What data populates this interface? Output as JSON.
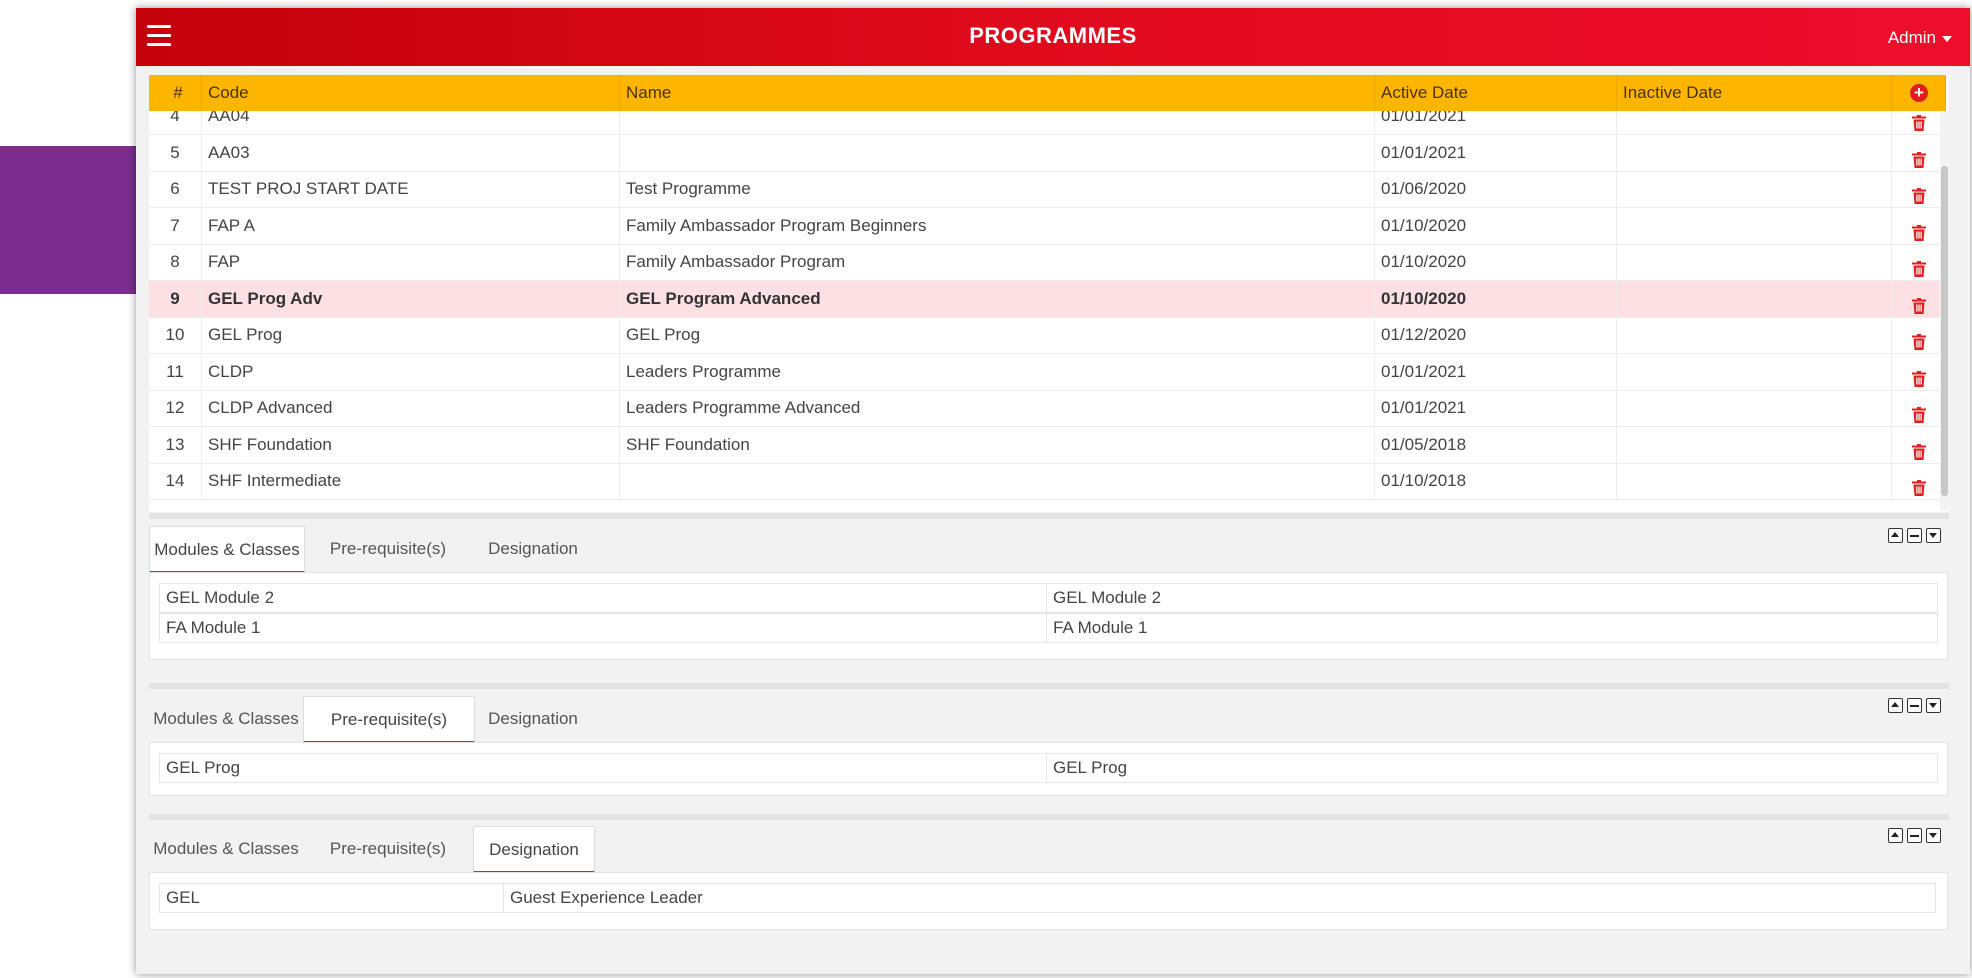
{
  "header": {
    "title": "PROGRAMMES",
    "user_menu": "Admin"
  },
  "grid": {
    "columns": [
      "#",
      "Code",
      "Name",
      "Active Date",
      "Inactive Date"
    ],
    "rows": [
      {
        "num": "4",
        "code": "AA04",
        "name": "",
        "active": "01/01/2021",
        "inactive": ""
      },
      {
        "num": "5",
        "code": "AA03",
        "name": "",
        "active": "01/01/2021",
        "inactive": ""
      },
      {
        "num": "6",
        "code": "TEST PROJ START DATE",
        "name": "Test Programme",
        "active": "01/06/2020",
        "inactive": ""
      },
      {
        "num": "7",
        "code": "FAP A",
        "name": "Family Ambassador Program Beginners",
        "active": "01/10/2020",
        "inactive": ""
      },
      {
        "num": "8",
        "code": "FAP",
        "name": "Family Ambassador Program",
        "active": "01/10/2020",
        "inactive": ""
      },
      {
        "num": "9",
        "code": "GEL Prog Adv",
        "name": "GEL Program Advanced",
        "active": "01/10/2020",
        "inactive": ""
      },
      {
        "num": "10",
        "code": "GEL Prog",
        "name": "GEL Prog",
        "active": "01/12/2020",
        "inactive": ""
      },
      {
        "num": "11",
        "code": "CLDP",
        "name": "Leaders Programme",
        "active": "01/01/2021",
        "inactive": ""
      },
      {
        "num": "12",
        "code": "CLDP Advanced",
        "name": "Leaders Programme Advanced",
        "active": "01/01/2021",
        "inactive": ""
      },
      {
        "num": "13",
        "code": "SHF Foundation",
        "name": "SHF Foundation",
        "active": "01/05/2018",
        "inactive": ""
      },
      {
        "num": "14",
        "code": "SHF Intermediate",
        "name": "",
        "active": "01/10/2018",
        "inactive": ""
      }
    ],
    "selected_row": "9"
  },
  "tabs": [
    "Modules & Classes",
    "Pre-requisite(s)",
    "Designation"
  ],
  "panels": {
    "modules": {
      "active_tab": "Modules & Classes",
      "rows": [
        [
          "GEL Module 2",
          "GEL Module 2"
        ],
        [
          "FA Module 1",
          "FA Module 1"
        ]
      ]
    },
    "prereq": {
      "active_tab": "Pre-requisite(s)",
      "rows": [
        [
          "GEL Prog",
          "GEL Prog"
        ]
      ]
    },
    "designation": {
      "active_tab": "Designation",
      "rows": [
        [
          "GEL",
          "Guest Experience Leader"
        ]
      ]
    }
  },
  "colors": {
    "header_red": "#e30b1f",
    "grid_header_yellow": "#fdb500",
    "selected_row": "#fde0e4",
    "accent_purple": "#7b2d8e",
    "delete_red": "#e01e1e"
  },
  "icons": {
    "menu": "hamburger-icon",
    "add": "plus-circle-icon",
    "delete": "trash-icon"
  }
}
